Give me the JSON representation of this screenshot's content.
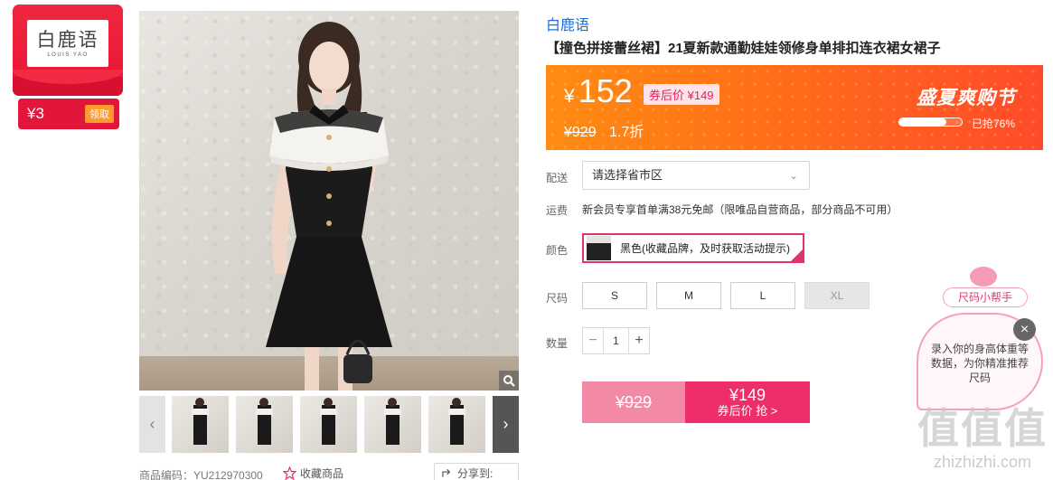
{
  "brand_card": {
    "logo_cn": "白鹿语",
    "logo_en": "LOUIS YAO",
    "coupon_amount": "¥3",
    "claim_label": "领取"
  },
  "product": {
    "brand": "白鹿语",
    "title": "【撞色拼接蕾丝裙】21夏新款通勤娃娃领修身单排扣连衣裙女裙子"
  },
  "price_banner": {
    "currency": "¥",
    "price": "152",
    "coupon_price": "券后价 ¥149",
    "original_price": "¥929",
    "discount": "1.7折",
    "promo_title": "盛夏爽购节",
    "sold_progress": 0.76,
    "sold_text": "已抢76%"
  },
  "labels": {
    "delivery": "配送",
    "shipping": "运费",
    "color": "颜色",
    "size": "尺码",
    "quantity": "数量"
  },
  "delivery": {
    "value": "请选择省市区"
  },
  "shipping": {
    "text": "新会员专享首单满38元免邮（限唯品自营商品，部分商品不可用）"
  },
  "color": {
    "selected": "黑色(收藏品牌，及时获取活动提示)"
  },
  "sizes": [
    "S",
    "M",
    "L",
    "XL"
  ],
  "quantity": {
    "value": "1",
    "minus": "−",
    "plus": "+"
  },
  "buy": {
    "original": "¥929",
    "price": "¥149",
    "cta": "券后价 抢 >"
  },
  "meta": {
    "code": "商品编码：YU212970300",
    "favorite": "收藏商品",
    "share": "分享到:"
  },
  "size_helper": {
    "title": "尺码小帮手",
    "text": "录入你的身高体重等数据，为你精准推荐尺码",
    "close": "×"
  },
  "watermark": {
    "big": "值值值",
    "small": "zhizhizhi.com"
  },
  "colors": {
    "brand_red": "#e81436",
    "banner_orange": "#ff6e17",
    "accent_pink": "#ee2e6a",
    "link_blue": "#1a6fd8"
  }
}
